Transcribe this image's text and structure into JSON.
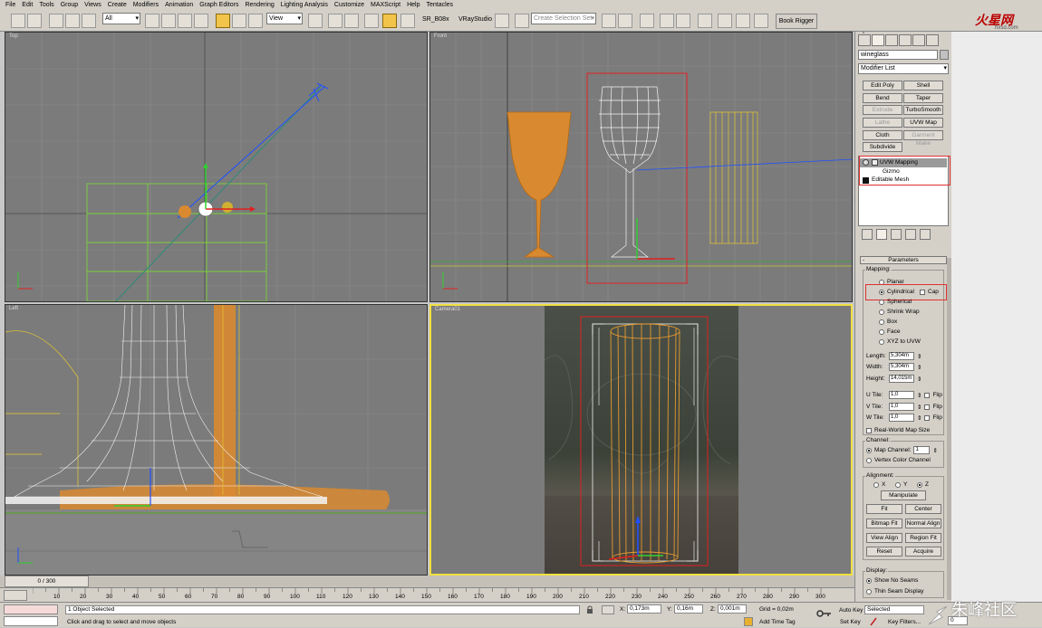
{
  "menu": [
    "File",
    "Edit",
    "Tools",
    "Group",
    "Views",
    "Create",
    "Modifiers",
    "Animation",
    "Graph Editors",
    "Rendering",
    "Lighting Analysis",
    "Customize",
    "MAXScript",
    "Help",
    "Tentacles"
  ],
  "toolbar": {
    "filter": "All",
    "ref_coord": "View",
    "selection_set_placeholder": "Create Selection Set",
    "label_sr": "SR_B08x",
    "label_vray": "VRayStudio",
    "book_rigger": "Book Rigger"
  },
  "watermark": {
    "site": "hxsd.com"
  },
  "viewports": {
    "top": "Top",
    "front": "Front",
    "left": "Left",
    "camera": "Camera01"
  },
  "panel": {
    "object_name": "wineglass",
    "modifier_list": "Modifier List",
    "modifier_buttons": [
      {
        "label": "Edit Poly",
        "disabled": false
      },
      {
        "label": "Shell",
        "disabled": false
      },
      {
        "label": "Bend",
        "disabled": false
      },
      {
        "label": "Taper",
        "disabled": false
      },
      {
        "label": "Extrude",
        "disabled": true
      },
      {
        "label": "TurboSmooth",
        "disabled": false
      },
      {
        "label": "Lathe",
        "disabled": true
      },
      {
        "label": "UVW Map",
        "disabled": false
      },
      {
        "label": "Cloth",
        "disabled": false
      },
      {
        "label": "Garment Make",
        "disabled": true
      },
      {
        "label": "Subdivide",
        "disabled": false
      }
    ],
    "stack": {
      "uvw": "UVW Mapping",
      "gizmo": "Gizmo",
      "mesh": "Editable Mesh"
    },
    "rollout": "Parameters",
    "mapping_title": "Mapping:",
    "mapping_options": [
      "Planar",
      "Cylindrical",
      "Spherical",
      "Shrink Wrap",
      "Box",
      "Face",
      "XYZ to UVW"
    ],
    "mapping_selected": "Cylindrical",
    "cap": "Cap",
    "length_label": "Length:",
    "length": "5,304m",
    "width_label": "Width:",
    "width": "5,304m",
    "height_label": "Height:",
    "height": "14,015m",
    "utile_label": "U Tile:",
    "utile": "1,0",
    "vtile_label": "V Tile:",
    "vtile": "1,0",
    "wtile_label": "W Tile:",
    "wtile": "1,0",
    "flip": "Flip",
    "realworld": "Real-World Map Size",
    "channel_title": "Channel:",
    "map_channel_label": "Map Channel:",
    "map_channel": "1",
    "vertex_color": "Vertex Color Channel",
    "alignment_title": "Alignment:",
    "axis_x": "X",
    "axis_y": "Y",
    "axis_z": "Z",
    "manipulate": "Manipulate",
    "fit": "Fit",
    "center": "Center",
    "bitmap_fit": "Bitmap Fit",
    "normal_align": "Normal Align",
    "view_align": "View Align",
    "region_fit": "Region Fit",
    "reset": "Reset",
    "acquire": "Acquire",
    "display_title": "Display:",
    "show_no_seams": "Show No Seams",
    "thin_seam": "Thin Seam Display"
  },
  "timeline": {
    "frame": "0 / 300",
    "ticks": [
      "10",
      "20",
      "30",
      "40",
      "50",
      "60",
      "70",
      "80",
      "90",
      "100",
      "110",
      "120",
      "130",
      "140",
      "150",
      "160",
      "170",
      "180",
      "190",
      "200",
      "210",
      "220",
      "230",
      "240",
      "250",
      "260",
      "270",
      "280",
      "290",
      "300"
    ]
  },
  "status": {
    "objects_selected": "1 Object Selected",
    "prompt": "Click and drag to select and move objects",
    "x_label": "X:",
    "x": "0,173m",
    "y_label": "Y:",
    "y": "0,16m",
    "z_label": "Z:",
    "z": "0,001m",
    "grid": "Grid = 0,02m",
    "add_time_tag": "Add Time Tag",
    "auto_key": "Auto Key",
    "set_key": "Set Key",
    "selected": "Selected",
    "key_filters": "Key Filters...",
    "frame_value": "0"
  },
  "brand": "朱峰社区"
}
